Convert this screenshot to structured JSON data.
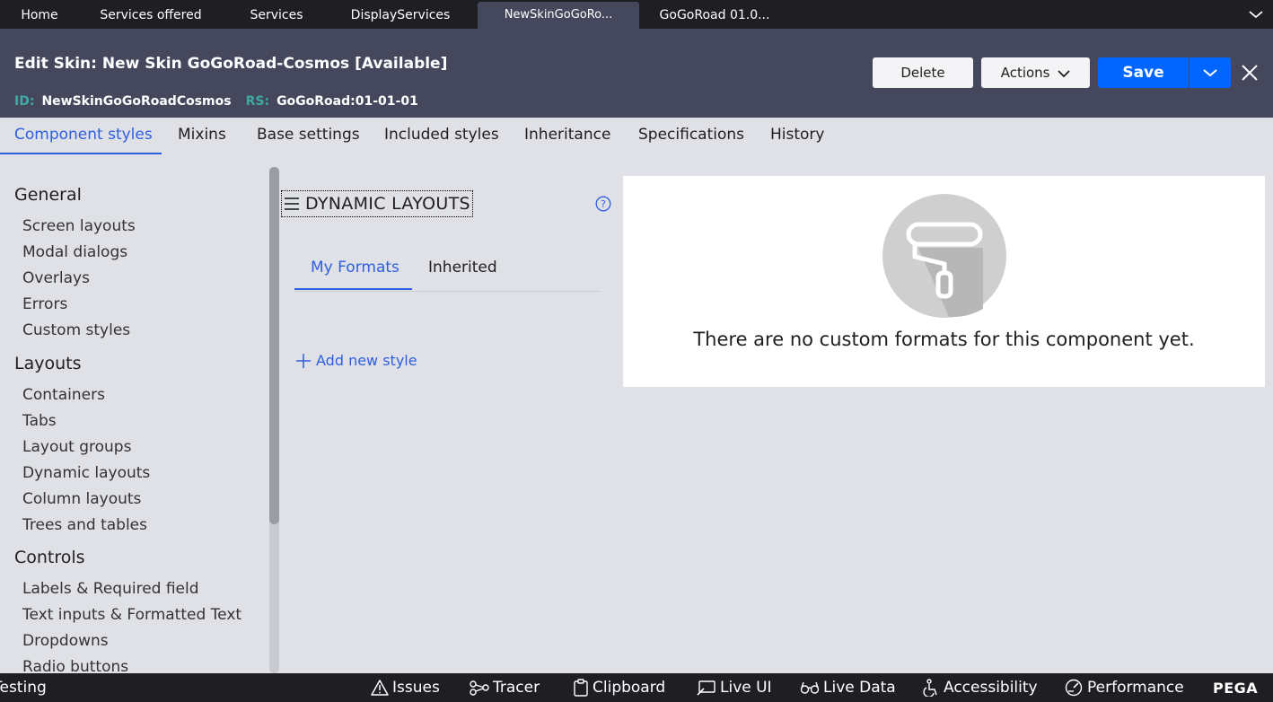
{
  "doc_tabs": {
    "items": [
      {
        "label": "Home"
      },
      {
        "label": "Services offered"
      },
      {
        "label": "Services"
      },
      {
        "label": "DisplayServices"
      },
      {
        "label": "NewSkinGoGoRo...",
        "active": true
      },
      {
        "label": "GoGoRoad 01.0..."
      }
    ],
    "menu_icon": "chevron-down-icon"
  },
  "header": {
    "title": "Edit Skin: New Skin GoGoRoad-Cosmos [Available]",
    "id_key": "ID:",
    "id_value": "NewSkinGoGoRoadCosmos",
    "rs_key": "RS:",
    "rs_value": "GoGoRoad:01-01-01",
    "delete_label": "Delete",
    "actions_label": "Actions",
    "save_label": "Save",
    "colors": {
      "header_bg": "#45475c",
      "primary": "#0066ff",
      "meta_key": "#3fa9a6"
    }
  },
  "main_tabs": [
    {
      "label": "Component styles",
      "active": true
    },
    {
      "label": "Mixins"
    },
    {
      "label": "Base settings"
    },
    {
      "label": "Included styles"
    },
    {
      "label": "Inheritance"
    },
    {
      "label": "Specifications"
    },
    {
      "label": "History"
    }
  ],
  "sidebar": {
    "sections": [
      {
        "heading": "General",
        "items": [
          "Screen layouts",
          "Modal dialogs",
          "Overlays",
          "Errors",
          "Custom styles"
        ]
      },
      {
        "heading": "Layouts",
        "items": [
          "Containers",
          "Tabs",
          "Layout groups",
          "Dynamic layouts",
          "Column layouts",
          "Trees and tables"
        ]
      },
      {
        "heading": "Controls",
        "items": [
          "Labels & Required field",
          "Text inputs & Formatted Text",
          "Dropdowns",
          "Radio buttons"
        ]
      }
    ]
  },
  "panel": {
    "title": "DYNAMIC LAYOUTS",
    "sub_tabs": [
      {
        "label": "My Formats",
        "active": true
      },
      {
        "label": "Inherited"
      }
    ],
    "add_label": "Add new style"
  },
  "empty_state": {
    "message": "There are no custom formats for this component yet.",
    "icon": "paint-roller-icon"
  },
  "bottom_bar": {
    "items": [
      {
        "label": "Testing",
        "icon": ""
      },
      {
        "label": "Issues",
        "icon": "warning-icon"
      },
      {
        "label": "Tracer",
        "icon": "tracer-icon"
      },
      {
        "label": "Clipboard",
        "icon": "clipboard-icon"
      },
      {
        "label": "Live UI",
        "icon": "live-ui-icon"
      },
      {
        "label": "Live Data",
        "icon": "glasses-icon"
      },
      {
        "label": "Accessibility",
        "icon": "accessibility-icon"
      },
      {
        "label": "Performance",
        "icon": "gauge-icon"
      }
    ],
    "brand": "PEGA"
  }
}
